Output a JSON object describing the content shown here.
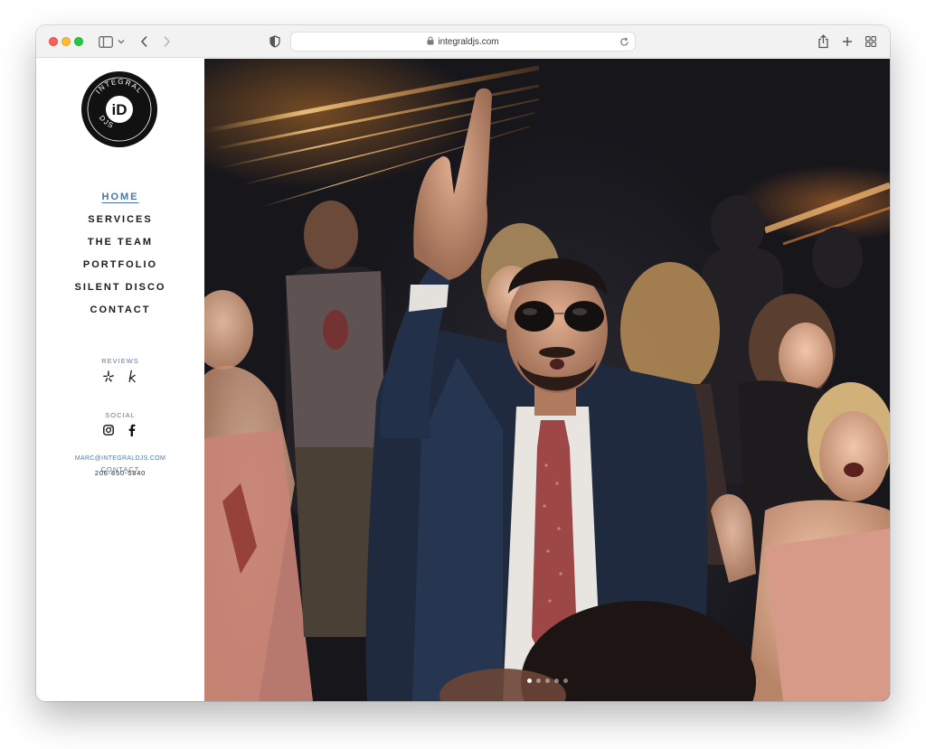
{
  "browser": {
    "url": "integraldjs.com"
  },
  "site": {
    "logo": {
      "text_top": "INTEGRAL",
      "text_bottom": "DJS",
      "monogram": "iD"
    },
    "menu": [
      {
        "label": "HOME",
        "active": true
      },
      {
        "label": "SERVICES",
        "active": false
      },
      {
        "label": "THE TEAM",
        "active": false
      },
      {
        "label": "PORTFOLIO",
        "active": false
      },
      {
        "label": "SILENT DISCO",
        "active": false
      },
      {
        "label": "CONTACT",
        "active": false
      }
    ],
    "reviews": {
      "label": "REVIEWS",
      "icons": [
        "yelp-icon",
        "the-knot-icon"
      ]
    },
    "social": {
      "label": "SOCIAL",
      "icons": [
        "instagram-icon",
        "facebook-icon"
      ]
    },
    "contact": {
      "label": "CONTACT",
      "email": "MARC@INTEGRALDJS.COM",
      "phone": "206-850-5840"
    }
  },
  "hero": {
    "slides": 5,
    "active_slide": 1
  },
  "colors": {
    "accent": "#4a73a8",
    "text": "#1b1b1b"
  }
}
